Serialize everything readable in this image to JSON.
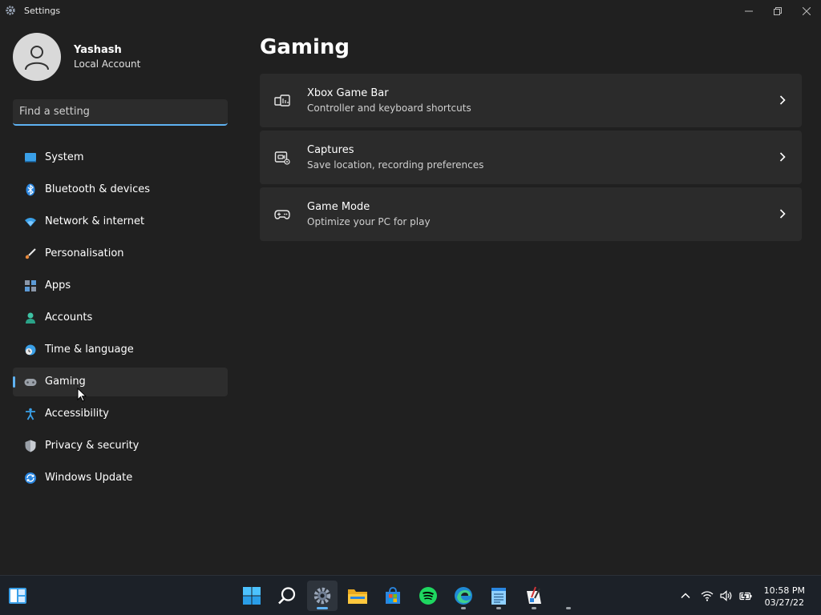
{
  "window": {
    "title": "Settings"
  },
  "profile": {
    "name": "Yashash",
    "account_type": "Local Account"
  },
  "search": {
    "placeholder": "Find a setting"
  },
  "sidebar": {
    "items": [
      {
        "label": "System",
        "icon": "monitor-icon",
        "selected": false
      },
      {
        "label": "Bluetooth & devices",
        "icon": "bluetooth-icon",
        "selected": false
      },
      {
        "label": "Network & internet",
        "icon": "wifi-icon",
        "selected": false
      },
      {
        "label": "Personalisation",
        "icon": "brush-icon",
        "selected": false
      },
      {
        "label": "Apps",
        "icon": "apps-icon",
        "selected": false
      },
      {
        "label": "Accounts",
        "icon": "person-icon",
        "selected": false
      },
      {
        "label": "Time & language",
        "icon": "globe-clock-icon",
        "selected": false
      },
      {
        "label": "Gaming",
        "icon": "gamepad-icon",
        "selected": true
      },
      {
        "label": "Accessibility",
        "icon": "accessibility-icon",
        "selected": false
      },
      {
        "label": "Privacy & security",
        "icon": "shield-icon",
        "selected": false
      },
      {
        "label": "Windows Update",
        "icon": "update-icon",
        "selected": false
      }
    ]
  },
  "main": {
    "title": "Gaming",
    "cards": [
      {
        "title": "Xbox Game Bar",
        "subtitle": "Controller and keyboard shortcuts",
        "icon": "game-bar-icon"
      },
      {
        "title": "Captures",
        "subtitle": "Save location, recording preferences",
        "icon": "capture-icon"
      },
      {
        "title": "Game Mode",
        "subtitle": "Optimize your PC for play",
        "icon": "gamepad-icon"
      }
    ]
  },
  "taskbar": {
    "apps": [
      "widgets-icon",
      "start-icon",
      "search-icon",
      "settings-icon",
      "file-explorer-icon",
      "store-icon",
      "spotify-icon",
      "edge-icon",
      "notepad-icon",
      "paint-icon"
    ],
    "clock_time": "10:58 PM",
    "clock_date": "03/27/22"
  },
  "colors": {
    "background": "#202020",
    "card": "#2b2b2b",
    "accent": "#5fb2f2",
    "taskbar": "#1c2128"
  }
}
